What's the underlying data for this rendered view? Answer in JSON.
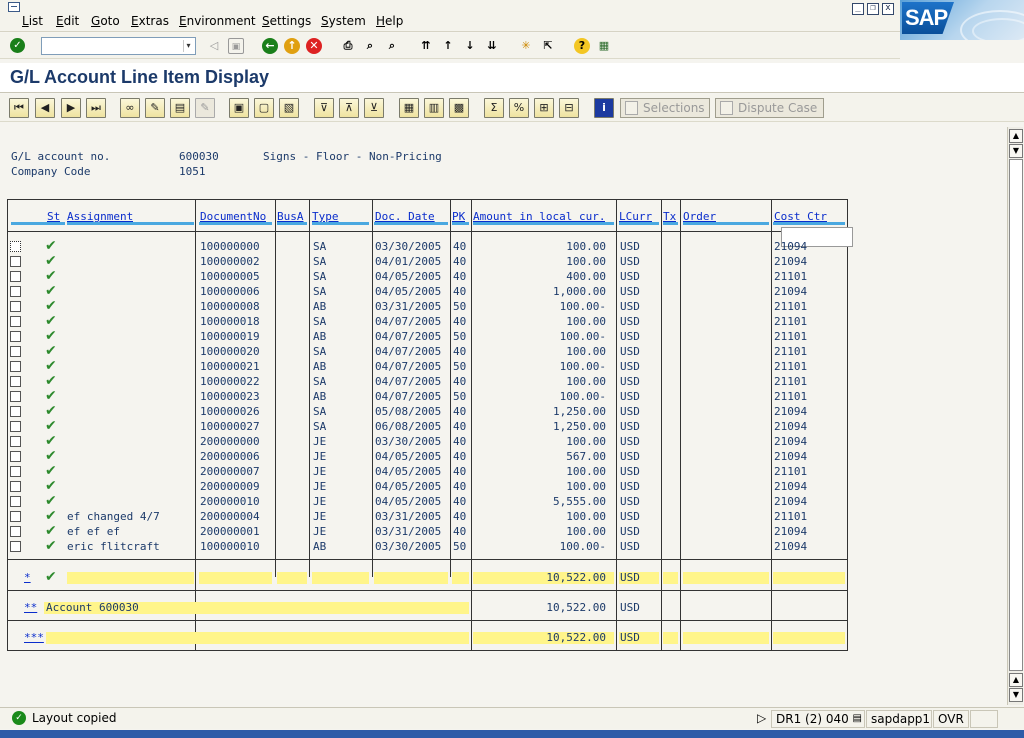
{
  "menu": {
    "items": [
      "List",
      "Edit",
      "Goto",
      "Extras",
      "Environment",
      "Settings",
      "System",
      "Help"
    ],
    "logo_text": "SAP"
  },
  "command_field": {
    "value": "",
    "placeholder": ""
  },
  "title": "G/L Account Line Item Display",
  "app_toolbar": {
    "selections_label": "Selections",
    "dispute_case_label": "Dispute Case"
  },
  "header": {
    "gl_account_label": "G/L account no.",
    "gl_account_value": "600030",
    "gl_account_desc": "Signs - Floor - Non-Pricing",
    "company_code_label": "Company Code",
    "company_code_value": "1051"
  },
  "table": {
    "columns": [
      "St",
      "Assignment",
      "DocumentNo",
      "BusA",
      "Type",
      "Doc. Date",
      "PK",
      "Amount in local cur.",
      "LCurr",
      "Tx",
      "Order",
      "Cost Ctr"
    ],
    "rows": [
      {
        "assignment": "",
        "doc": "100000000",
        "type": "SA",
        "date": "03/30/2005",
        "pk": "40",
        "amount": "100.00",
        "curr": "USD",
        "ctr": "21094"
      },
      {
        "assignment": "",
        "doc": "100000002",
        "type": "SA",
        "date": "04/01/2005",
        "pk": "40",
        "amount": "100.00",
        "curr": "USD",
        "ctr": "21094"
      },
      {
        "assignment": "",
        "doc": "100000005",
        "type": "SA",
        "date": "04/05/2005",
        "pk": "40",
        "amount": "400.00",
        "curr": "USD",
        "ctr": "21101"
      },
      {
        "assignment": "",
        "doc": "100000006",
        "type": "SA",
        "date": "04/05/2005",
        "pk": "40",
        "amount": "1,000.00",
        "curr": "USD",
        "ctr": "21094"
      },
      {
        "assignment": "",
        "doc": "100000008",
        "type": "AB",
        "date": "03/31/2005",
        "pk": "50",
        "amount": "100.00-",
        "curr": "USD",
        "ctr": "21101"
      },
      {
        "assignment": "",
        "doc": "100000018",
        "type": "SA",
        "date": "04/07/2005",
        "pk": "40",
        "amount": "100.00",
        "curr": "USD",
        "ctr": "21101"
      },
      {
        "assignment": "",
        "doc": "100000019",
        "type": "AB",
        "date": "04/07/2005",
        "pk": "50",
        "amount": "100.00-",
        "curr": "USD",
        "ctr": "21101"
      },
      {
        "assignment": "",
        "doc": "100000020",
        "type": "SA",
        "date": "04/07/2005",
        "pk": "40",
        "amount": "100.00",
        "curr": "USD",
        "ctr": "21101"
      },
      {
        "assignment": "",
        "doc": "100000021",
        "type": "AB",
        "date": "04/07/2005",
        "pk": "50",
        "amount": "100.00-",
        "curr": "USD",
        "ctr": "21101"
      },
      {
        "assignment": "",
        "doc": "100000022",
        "type": "SA",
        "date": "04/07/2005",
        "pk": "40",
        "amount": "100.00",
        "curr": "USD",
        "ctr": "21101"
      },
      {
        "assignment": "",
        "doc": "100000023",
        "type": "AB",
        "date": "04/07/2005",
        "pk": "50",
        "amount": "100.00-",
        "curr": "USD",
        "ctr": "21101"
      },
      {
        "assignment": "",
        "doc": "100000026",
        "type": "SA",
        "date": "05/08/2005",
        "pk": "40",
        "amount": "1,250.00",
        "curr": "USD",
        "ctr": "21094"
      },
      {
        "assignment": "",
        "doc": "100000027",
        "type": "SA",
        "date": "06/08/2005",
        "pk": "40",
        "amount": "1,250.00",
        "curr": "USD",
        "ctr": "21094"
      },
      {
        "assignment": "",
        "doc": "200000000",
        "type": "JE",
        "date": "03/30/2005",
        "pk": "40",
        "amount": "100.00",
        "curr": "USD",
        "ctr": "21094"
      },
      {
        "assignment": "",
        "doc": "200000006",
        "type": "JE",
        "date": "04/05/2005",
        "pk": "40",
        "amount": "567.00",
        "curr": "USD",
        "ctr": "21094"
      },
      {
        "assignment": "",
        "doc": "200000007",
        "type": "JE",
        "date": "04/05/2005",
        "pk": "40",
        "amount": "100.00",
        "curr": "USD",
        "ctr": "21101"
      },
      {
        "assignment": "",
        "doc": "200000009",
        "type": "JE",
        "date": "04/05/2005",
        "pk": "40",
        "amount": "100.00",
        "curr": "USD",
        "ctr": "21094"
      },
      {
        "assignment": "",
        "doc": "200000010",
        "type": "JE",
        "date": "04/05/2005",
        "pk": "40",
        "amount": "5,555.00",
        "curr": "USD",
        "ctr": "21094"
      },
      {
        "assignment": "ef changed 4/7",
        "doc": "200000004",
        "type": "JE",
        "date": "03/31/2005",
        "pk": "40",
        "amount": "100.00",
        "curr": "USD",
        "ctr": "21101"
      },
      {
        "assignment": "ef ef ef",
        "doc": "200000001",
        "type": "JE",
        "date": "03/31/2005",
        "pk": "40",
        "amount": "100.00",
        "curr": "USD",
        "ctr": "21094"
      },
      {
        "assignment": "eric flitcraft",
        "doc": "100000010",
        "type": "AB",
        "date": "03/30/2005",
        "pk": "50",
        "amount": "100.00-",
        "curr": "USD",
        "ctr": "21094"
      }
    ],
    "totals": [
      {
        "label": "*",
        "amount": "10,522.00",
        "curr": "USD"
      },
      {
        "label": "**",
        "desc": "Account 600030",
        "amount": "10,522.00",
        "curr": "USD"
      },
      {
        "label": "***",
        "amount": "10,522.00",
        "curr": "USD"
      }
    ]
  },
  "status": {
    "message": "Layout copied",
    "system": "DR1 (2) 040",
    "server": "sapdapp1",
    "mode": "OVR"
  },
  "colors": {
    "link_blue": "#0a2dcc",
    "header_bar": "#4aa8e0",
    "total_yellow": "#fff58a",
    "check_green": "#2e8a2e"
  }
}
